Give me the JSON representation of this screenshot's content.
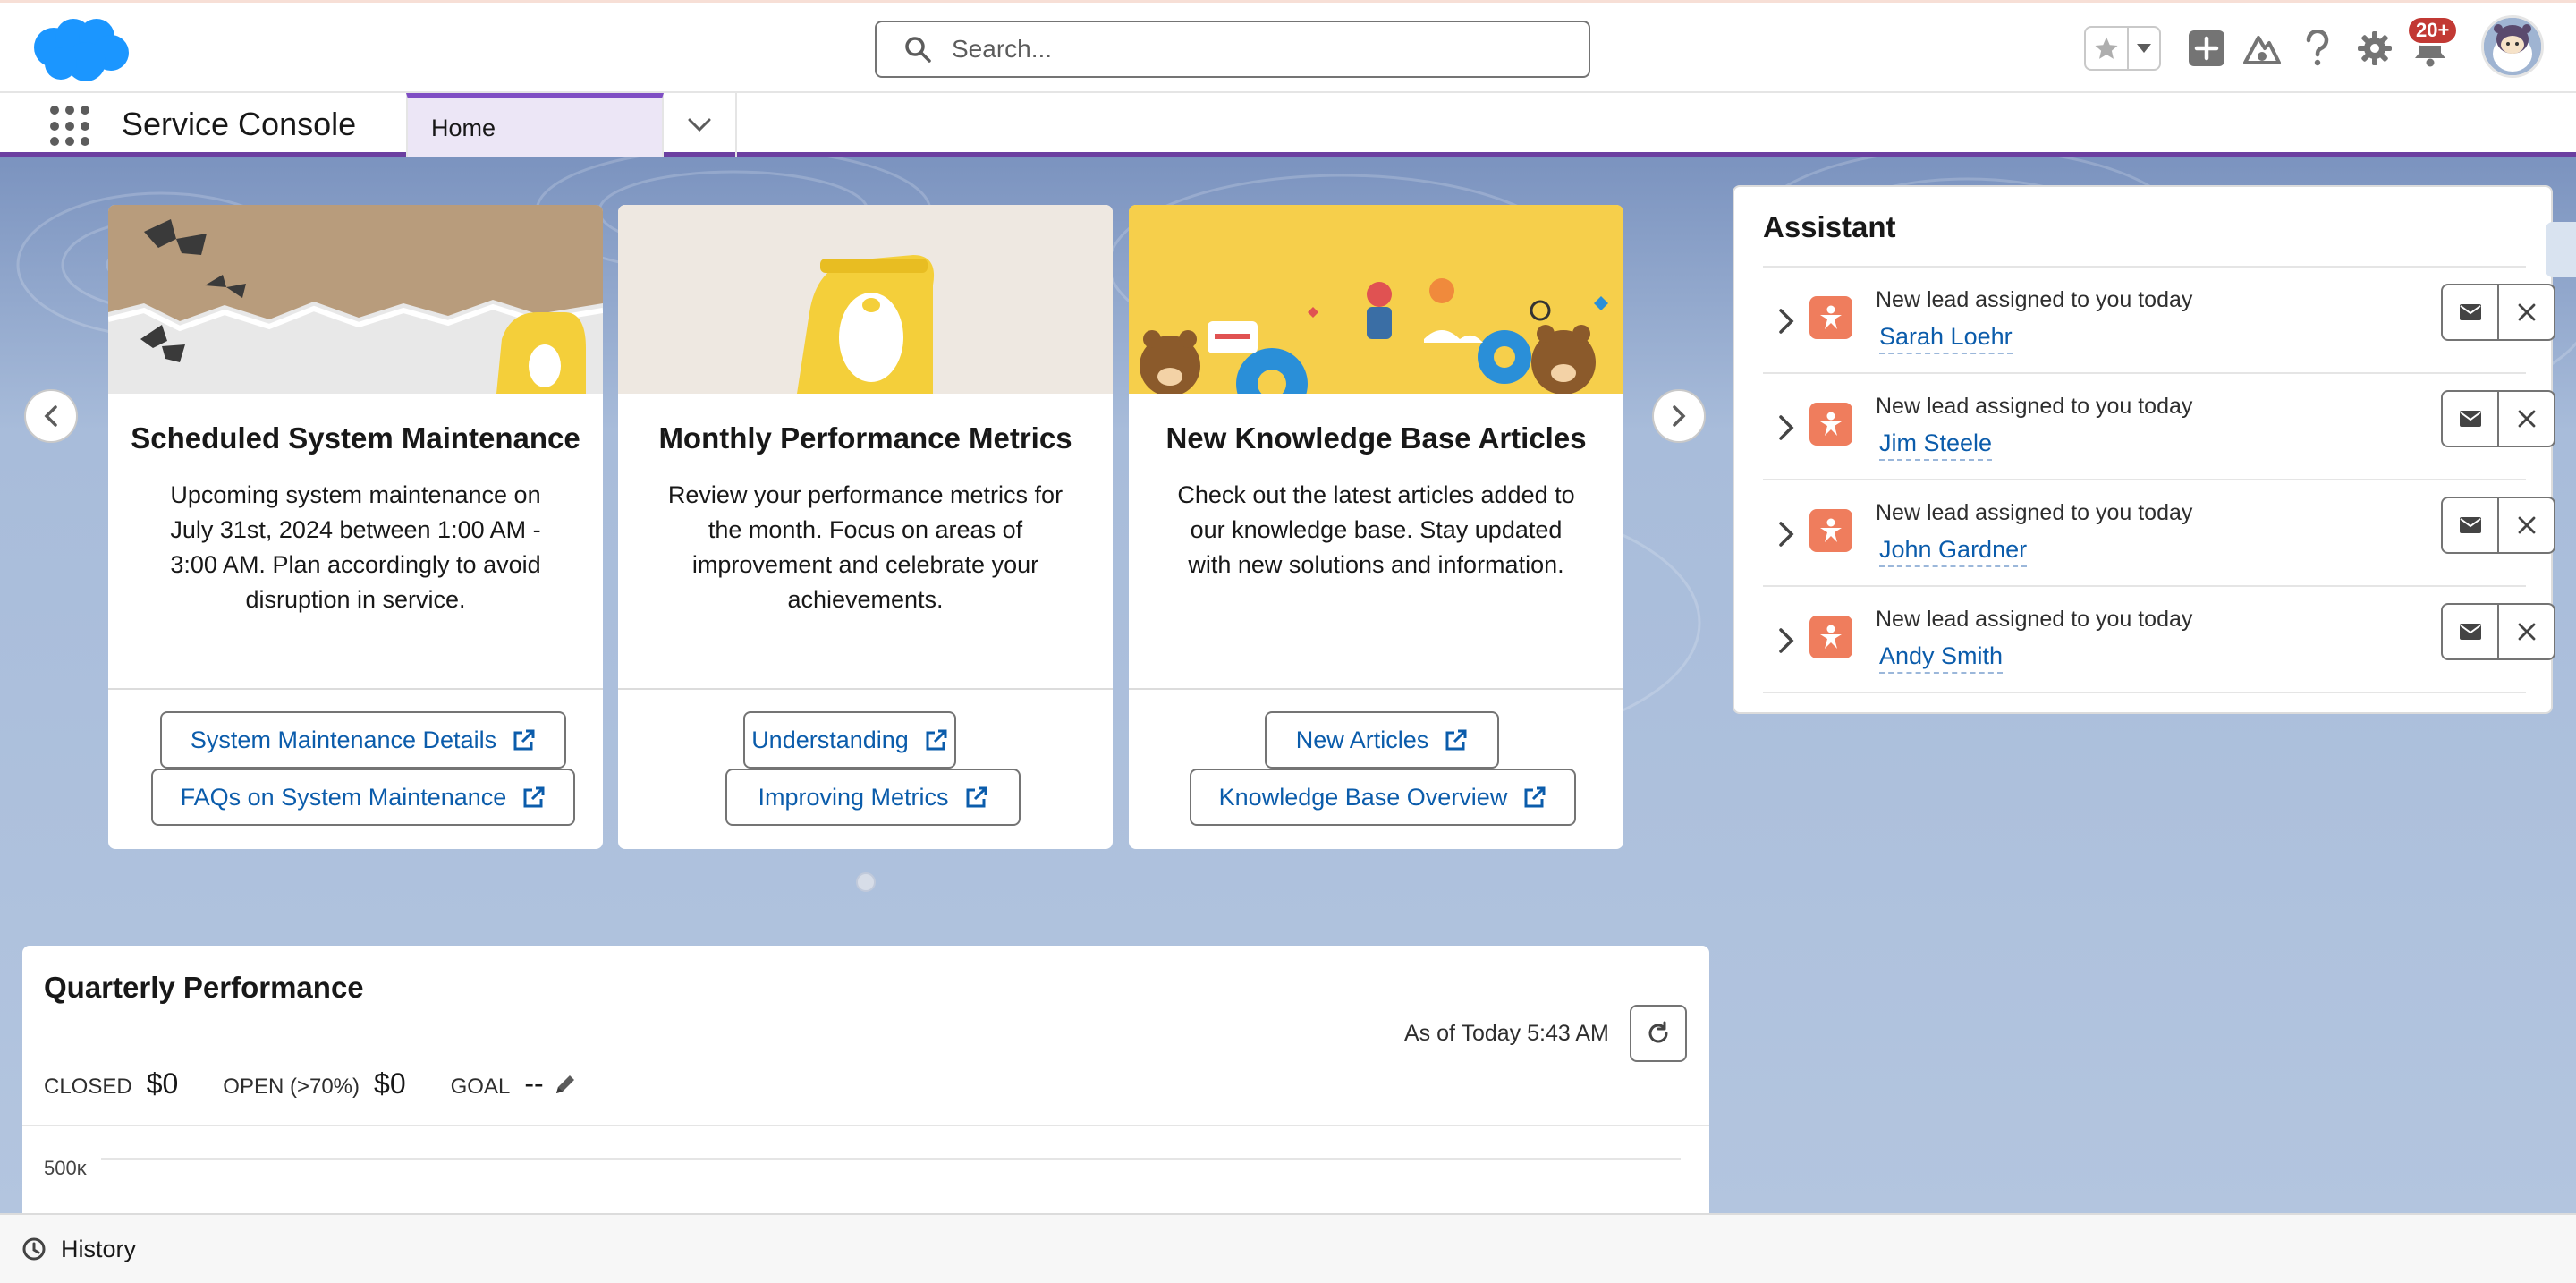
{
  "header": {
    "search_placeholder": "Search...",
    "notification_count": "20+"
  },
  "nav": {
    "app_name": "Service Console",
    "tabs": [
      {
        "label": "Home"
      }
    ]
  },
  "carousel": {
    "cards": [
      {
        "title": "Scheduled System Maintenance",
        "body": "Upcoming system maintenance on July 31st, 2024 between 1:00 AM - 3:00 AM. Plan accordingly to avoid disruption in service.",
        "links": [
          "System Maintenance Details",
          "FAQs on System Maintenance"
        ]
      },
      {
        "title": "Monthly Performance Metrics",
        "body": "Review your performance metrics for the month. Focus on areas of improvement and celebrate your achievements.",
        "links": [
          "Understanding",
          "Improving Metrics"
        ]
      },
      {
        "title": "New Knowledge Base Articles",
        "body": "Check out the latest articles added to our knowledge base. Stay updated with new solutions and information.",
        "links": [
          "New Articles",
          "Knowledge Base Overview"
        ]
      }
    ]
  },
  "assistant": {
    "title": "Assistant",
    "items": [
      {
        "text": "New lead assigned to you today",
        "name": "Sarah Loehr"
      },
      {
        "text": "New lead assigned to you today",
        "name": "Jim Steele"
      },
      {
        "text": "New lead assigned to you today",
        "name": "John Gardner"
      },
      {
        "text": "New lead assigned to you today",
        "name": "Andy Smith"
      }
    ]
  },
  "quarterly": {
    "title": "Quarterly Performance",
    "as_of": "As of Today 5:43 AM",
    "closed_label": "CLOSED",
    "closed_value": "$0",
    "open_label": "OPEN (>70%)",
    "open_value": "$0",
    "goal_label": "GOAL",
    "goal_value": "--",
    "y_tick": "500ĸ"
  },
  "footer": {
    "history_label": "History"
  },
  "colors": {
    "brand_blue": "#1b96ff",
    "link_blue": "#0b5cab",
    "nav_accent": "#6b3fa0",
    "lead_icon": "#ef7d5d",
    "badge_red": "#c23934"
  }
}
